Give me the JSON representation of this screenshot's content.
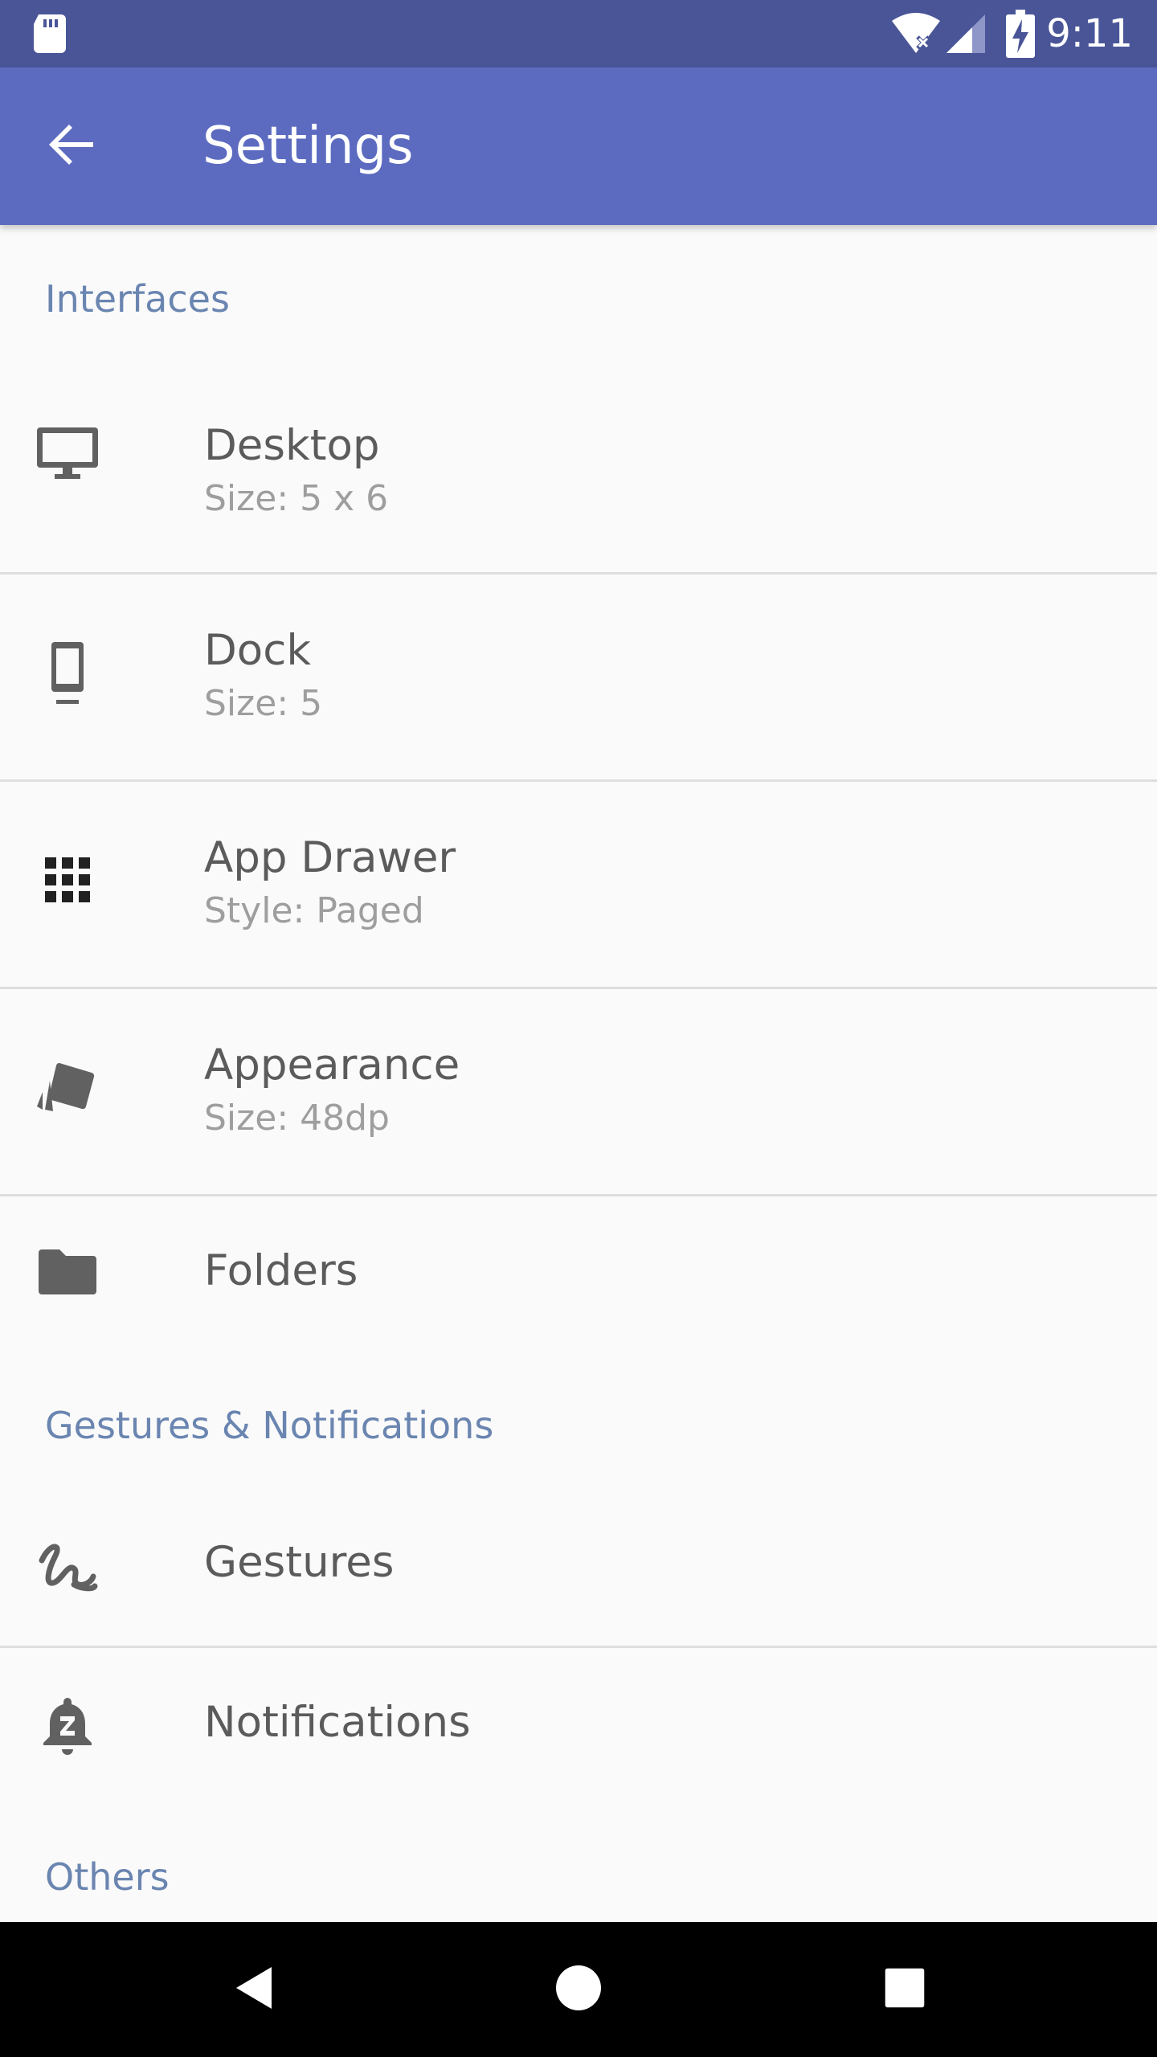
{
  "status_bar": {
    "time": "9:11",
    "icons": [
      "sd-card-icon",
      "wifi-no-internet-icon",
      "cell-signal-icon",
      "battery-charging-icon"
    ],
    "background": "#4a5598"
  },
  "app_bar": {
    "back_icon": "arrow-back-icon",
    "title": "Settings",
    "background": "#5c6bc0"
  },
  "sections": [
    {
      "header": "Interfaces",
      "items": [
        {
          "title": "Desktop",
          "summary": "Size: 5 x 6",
          "icon": "desktop-icon"
        },
        {
          "title": "Dock",
          "summary": "Size: 5",
          "icon": "phone-dock-icon"
        },
        {
          "title": "App Drawer",
          "summary": "Style: Paged",
          "icon": "apps-grid-icon"
        },
        {
          "title": "Appearance",
          "summary": "Size: 48dp",
          "icon": "style-cards-icon"
        },
        {
          "title": "Folders",
          "icon": "folder-icon"
        }
      ]
    },
    {
      "header": "Gestures & Notifications",
      "items": [
        {
          "title": "Gestures",
          "icon": "gesture-icon"
        },
        {
          "title": "Notifications",
          "icon": "notifications-paused-icon"
        }
      ]
    },
    {
      "header": "Others",
      "items": []
    }
  ],
  "nav_bar": {
    "buttons": [
      "back-triangle-icon",
      "home-circle-icon",
      "recents-square-icon"
    ]
  },
  "colors": {
    "section_header": "#6a85b0",
    "item_title": "#5b5b5b",
    "item_summary": "#9e9e9e",
    "background": "#fafafa"
  }
}
